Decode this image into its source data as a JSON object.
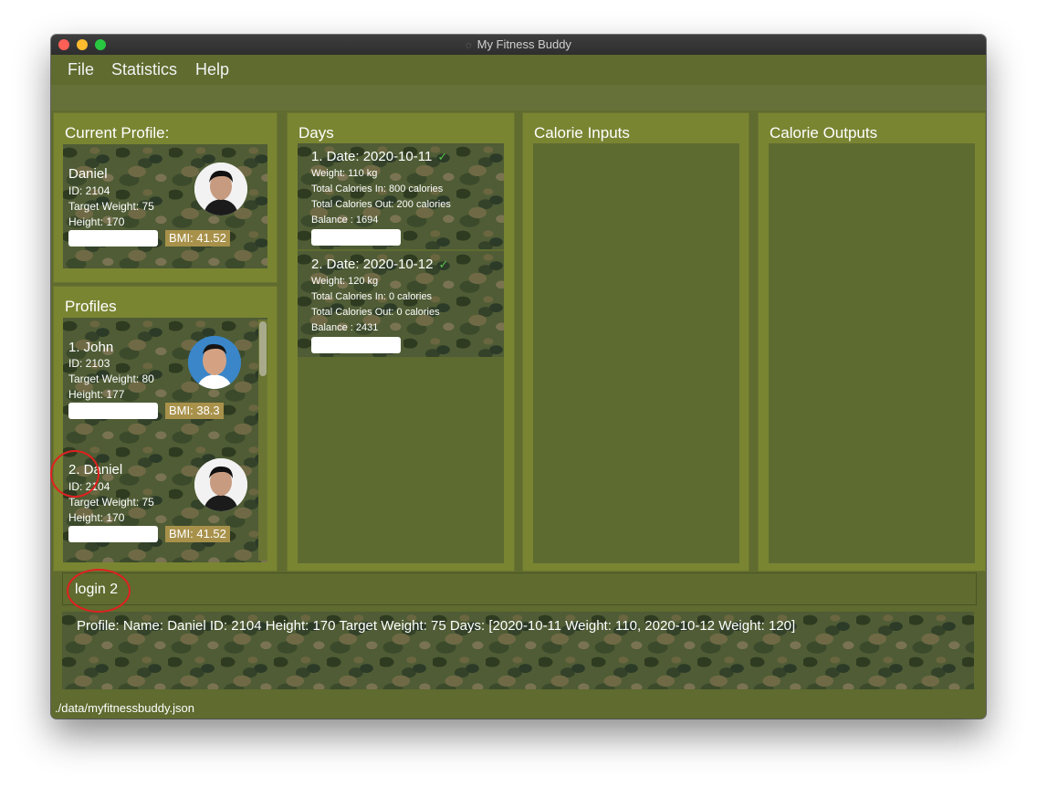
{
  "window": {
    "title": "My Fitness Buddy"
  },
  "menu": {
    "items": [
      "File",
      "Statistics",
      "Help"
    ]
  },
  "current_profile": {
    "title": "Current Profile:",
    "name": "Daniel",
    "id": "ID: 2104",
    "target_weight": "Target Weight: 75",
    "height": "Height: 170",
    "bmi": "BMI: 41.52"
  },
  "profiles": {
    "title": "Profiles",
    "items": [
      {
        "index_name": "1.  John",
        "id": "ID: 2103",
        "target_weight": "Target Weight: 80",
        "height": "Height: 177",
        "bmi": "BMI: 38.3"
      },
      {
        "index_name": "2.  Daniel",
        "id": "ID: 2104",
        "target_weight": "Target Weight: 75",
        "height": "Height: 170",
        "bmi": "BMI: 41.52"
      }
    ]
  },
  "days": {
    "title": "Days",
    "items": [
      {
        "title": "1.  Date: 2020-10-11",
        "check": "✓",
        "weight": "Weight: 110 kg",
        "cal_in": "Total Calories In: 800 calories",
        "cal_out": "Total Calories Out: 200 calories",
        "balance": "Balance : 1694"
      },
      {
        "title": "2.  Date: 2020-10-12",
        "check": "✓",
        "weight": "Weight: 120 kg",
        "cal_in": "Total Calories In: 0 calories",
        "cal_out": "Total Calories Out: 0 calories",
        "balance": "Balance : 2431"
      }
    ]
  },
  "calorie_inputs": {
    "title": "Calorie Inputs"
  },
  "calorie_outputs": {
    "title": "Calorie Outputs"
  },
  "command": {
    "value": "login 2"
  },
  "result": {
    "text": "Profile:  Name: Daniel ID: 2104 Height: 170 Target Weight: 75 Days: [2020-10-11 Weight: 110, 2020-10-12 Weight: 120]"
  },
  "status": {
    "path": "./data/myfitnessbuddy.json"
  },
  "colors": {
    "accent": "#7a8532",
    "bmi_badge": "#a8914a",
    "check": "#5ac34b",
    "annotation": "#e02020"
  }
}
